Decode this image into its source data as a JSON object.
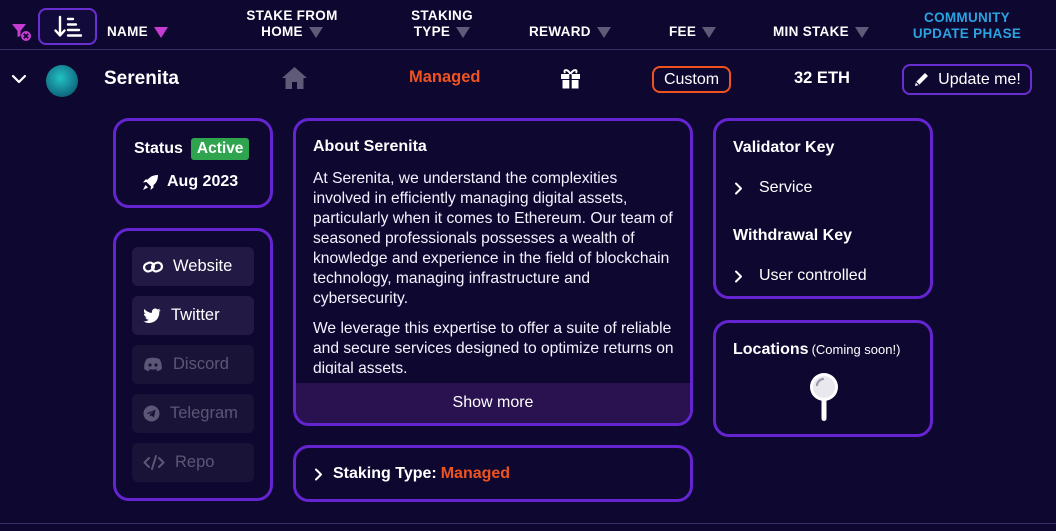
{
  "header": {
    "name": "NAME",
    "stake_from_home_1": "STAKE FROM",
    "stake_from_home_2": "HOME",
    "staking_type_1": "STAKING",
    "staking_type_2": "TYPE",
    "reward": "REWARD",
    "fee": "FEE",
    "min_stake": "MIN STAKE",
    "community_1": "COMMUNITY",
    "community_2": "UPDATE PHASE",
    "icons": {
      "filter": "filter-clear-icon",
      "sort": "sort-descending-icon"
    },
    "colors": {
      "community": "#2aa3e0",
      "active_filter": "#c63bd0"
    }
  },
  "operator": {
    "name": "Serenita",
    "staking_type": "Managed",
    "fee": "Custom",
    "min_stake": "32 ETH",
    "update_label": "Update me!",
    "icons": {
      "stake_from_home": "home-icon",
      "reward": "gift-icon",
      "update": "pencil-icon",
      "expand": "chevron-down-icon"
    }
  },
  "status_card": {
    "label": "Status",
    "status": "Active",
    "date": "Aug 2023",
    "icon": "rocket-icon"
  },
  "links": [
    {
      "label": "Website",
      "icon": "link-icon",
      "enabled": true
    },
    {
      "label": "Twitter",
      "icon": "twitter-icon",
      "enabled": true
    },
    {
      "label": "Discord",
      "icon": "discord-icon",
      "enabled": false
    },
    {
      "label": "Telegram",
      "icon": "telegram-icon",
      "enabled": false
    },
    {
      "label": "Repo",
      "icon": "code-icon",
      "enabled": false
    }
  ],
  "about": {
    "title": "About Serenita",
    "p1": "At Serenita, we understand the complexities involved in efficiently managing digital assets, particularly when it comes to Ethereum. Our team of seasoned professionals possesses a wealth of knowledge and experience in the field of blockchain technology, managing infrastructure and cybersecurity.",
    "p2": "We leverage this expertise to offer a suite of reliable and secure services designed to optimize returns on digital assets.",
    "show_more": "Show more"
  },
  "staking_type_row": {
    "label": "Staking Type:",
    "value": "Managed"
  },
  "keys": {
    "validator_title": "Validator Key",
    "validator_value": "Service",
    "withdrawal_title": "Withdrawal Key",
    "withdrawal_value": "User controlled"
  },
  "locations": {
    "title": "Locations",
    "subtitle": "(Coming soon!)",
    "icon": "map-pin-icon"
  },
  "colors": {
    "background": "#0e0730",
    "card_border": "#6424d0",
    "accent_orange": "#f0531f",
    "active_green": "#2ea44f"
  }
}
